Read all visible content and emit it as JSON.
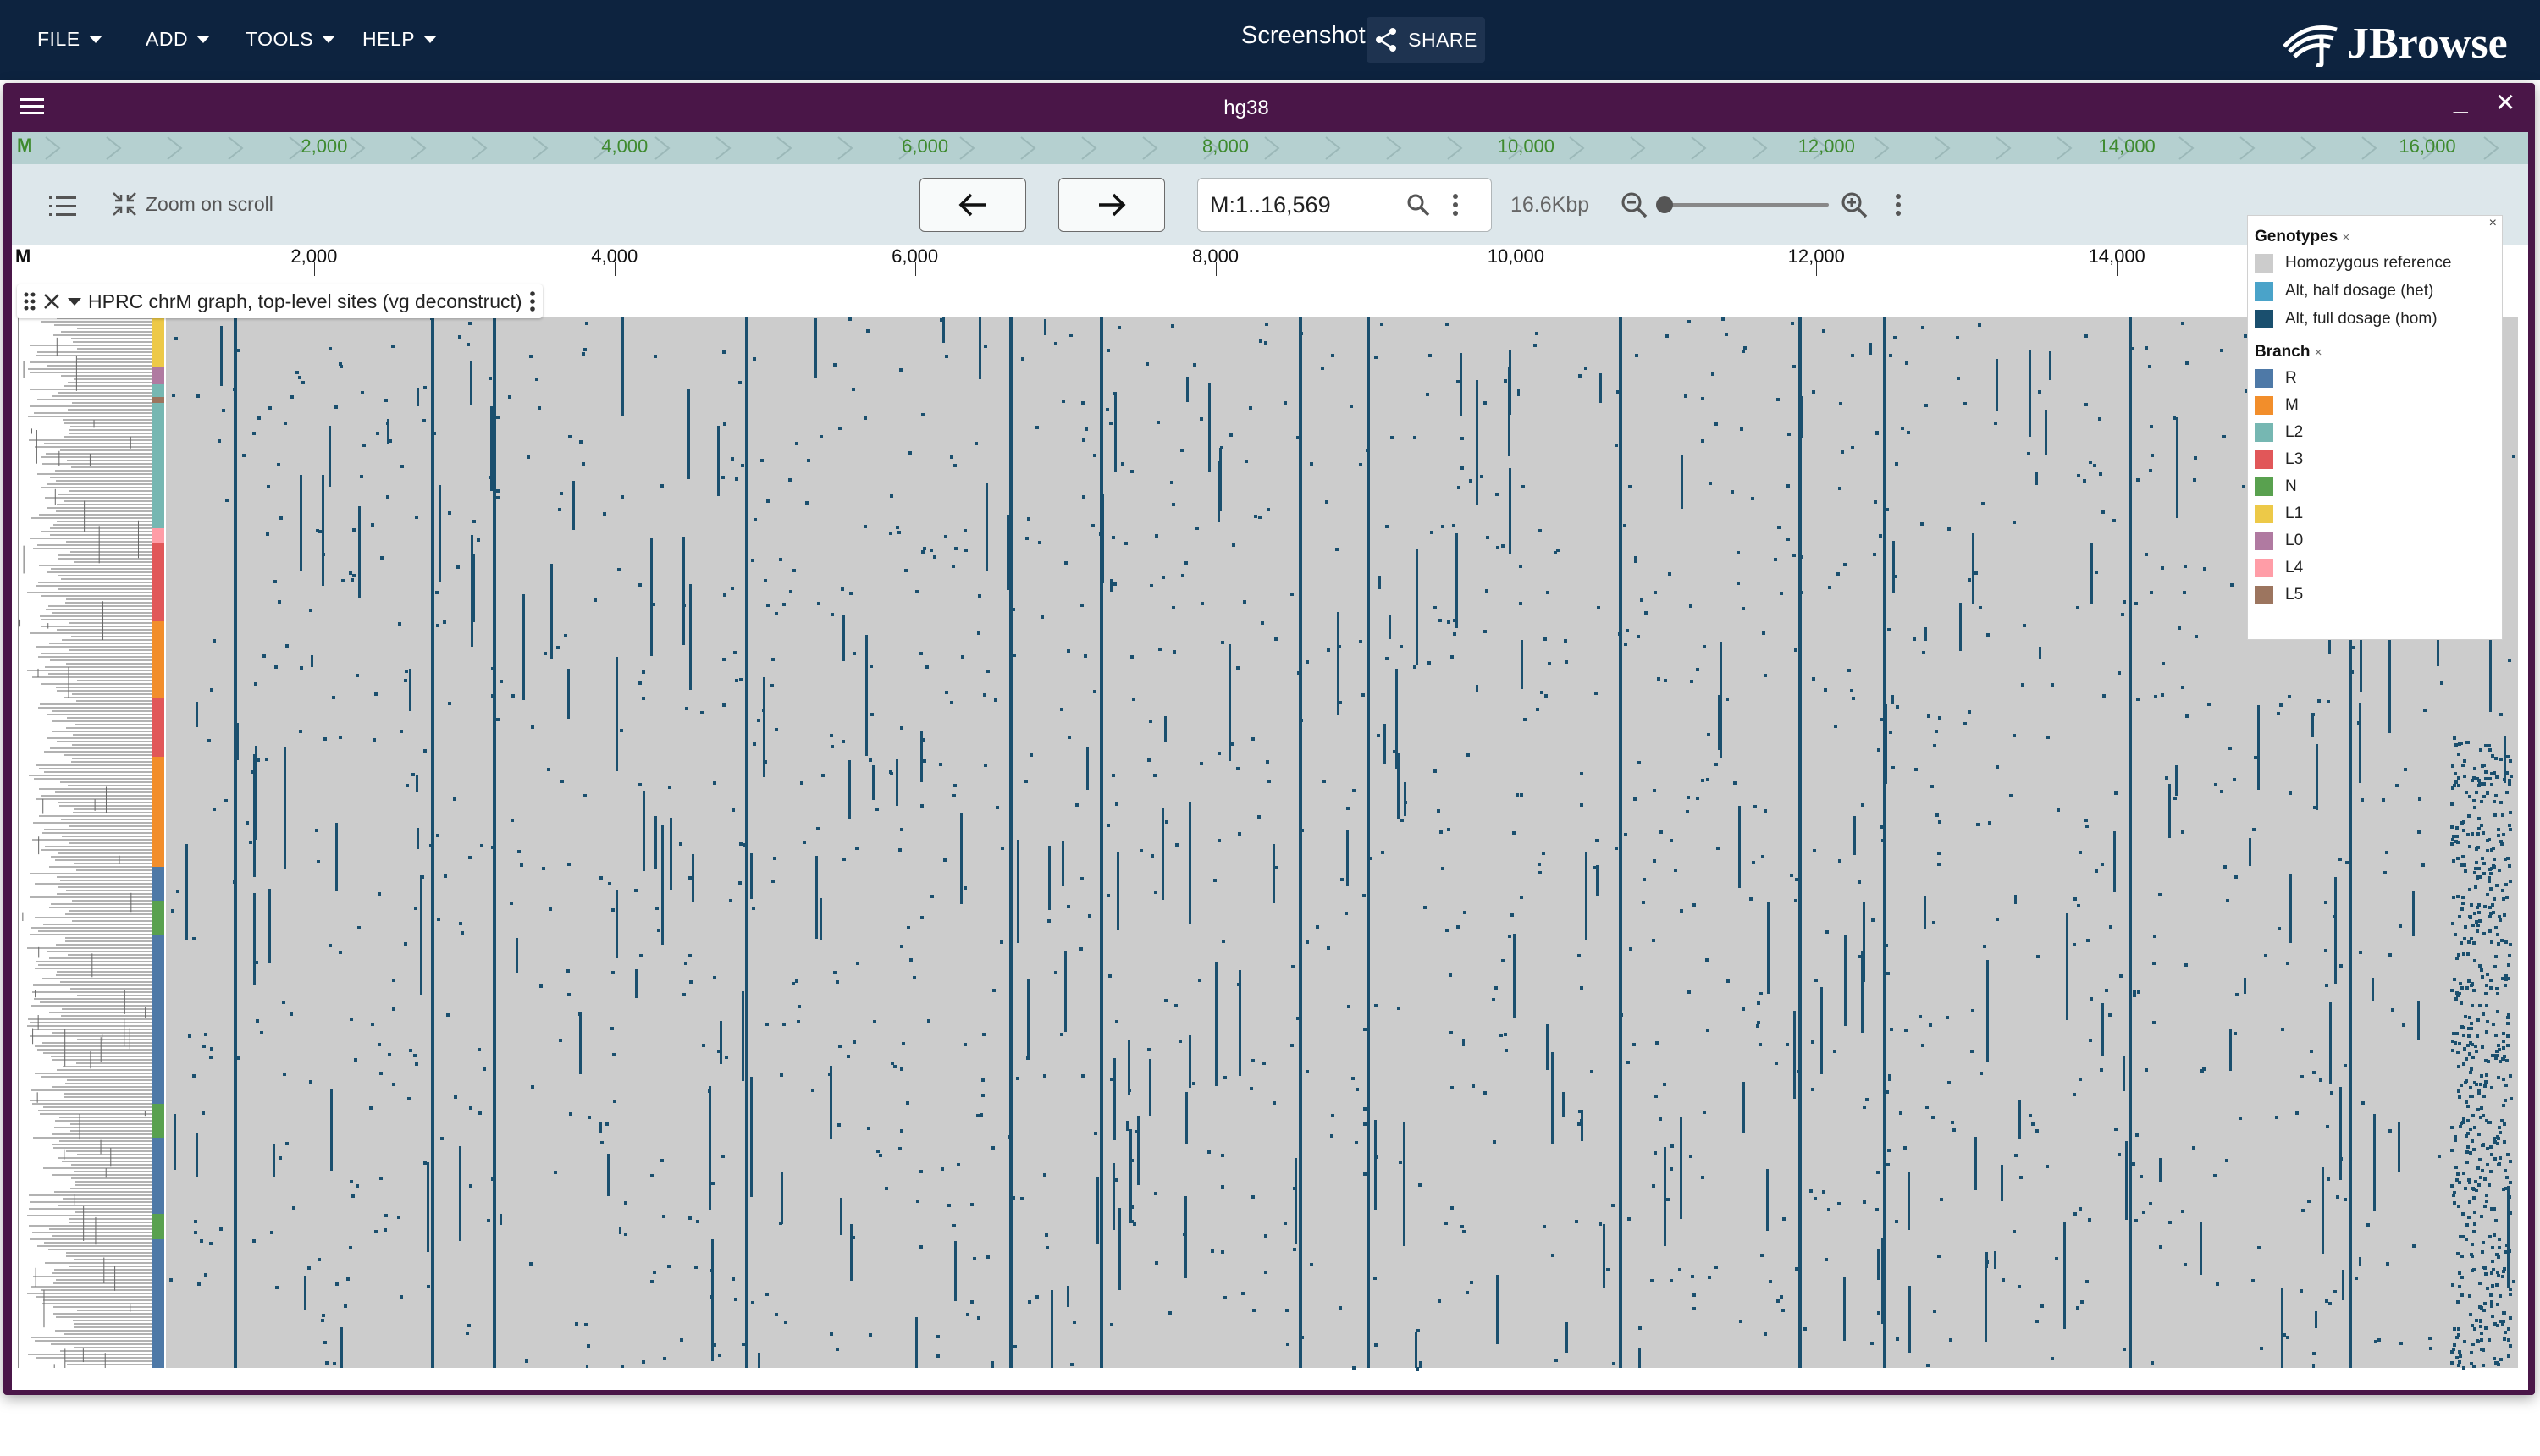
{
  "app": {
    "logo_text": "JBrowse"
  },
  "menu": [
    {
      "label": "FILE"
    },
    {
      "label": "ADD"
    },
    {
      "label": "TOOLS"
    },
    {
      "label": "HELP"
    }
  ],
  "header": {
    "screenshot_label": "Screenshot",
    "share_label": "SHARE"
  },
  "view": {
    "title": "hg38",
    "minimize_glyph": "_",
    "close_glyph": "×"
  },
  "overview": {
    "region": "M",
    "labels": [
      "2,000",
      "4,000",
      "6,000",
      "8,000",
      "10,000",
      "12,000",
      "14,000",
      "16,000"
    ]
  },
  "toolbar": {
    "zoom_on_scroll": "Zoom on scroll",
    "locstring": "M:1..16,569",
    "span": "16.6Kbp",
    "zoom_level": 0.01
  },
  "ruler": {
    "region": "M",
    "labels": [
      "2,000",
      "4,000",
      "6,000",
      "8,000",
      "10,000",
      "12,000",
      "14,000",
      "16,000"
    ]
  },
  "track": {
    "label": "HPRC chrM graph, top-level sites (vg deconstruct)"
  },
  "legend": {
    "genotypes_title": "Genotypes",
    "genotypes": [
      {
        "label": "Homozygous reference",
        "color": "#cccccc"
      },
      {
        "label": "Alt, half dosage (het)",
        "color": "#4aa3c9"
      },
      {
        "label": "Alt, full dosage (hom)",
        "color": "#1a4f6e"
      }
    ],
    "branch_title": "Branch",
    "branches": [
      {
        "label": "R",
        "color": "#4e79a7"
      },
      {
        "label": "M",
        "color": "#f28e2b"
      },
      {
        "label": "L2",
        "color": "#76b7b2"
      },
      {
        "label": "L3",
        "color": "#e15759"
      },
      {
        "label": "N",
        "color": "#59a14f"
      },
      {
        "label": "L1",
        "color": "#edc948"
      },
      {
        "label": "L0",
        "color": "#b07aa1"
      },
      {
        "label": "L4",
        "color": "#ff9da7"
      },
      {
        "label": "L5",
        "color": "#9c755f"
      }
    ],
    "dismiss_glyph": "×"
  }
}
